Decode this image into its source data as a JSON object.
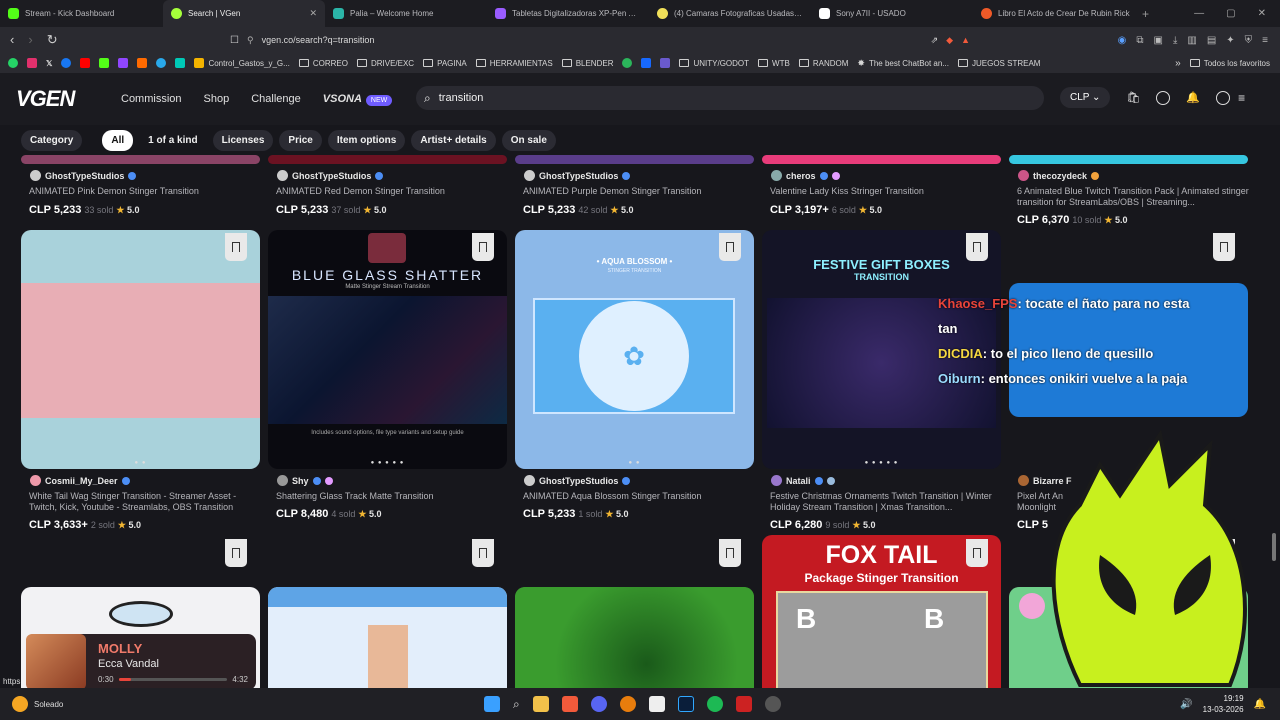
{
  "browser": {
    "tabs": [
      {
        "title": "Stream - Kick Dashboard",
        "color": "#53fc18"
      },
      {
        "title": "Search | VGen",
        "color": "#a6ff3b"
      },
      {
        "title": "Palia – Welcome Home",
        "color": "#2bb5a8"
      },
      {
        "title": "Tabletas Digitalizadoras XP-Pen Artis",
        "color": "#9a5cff"
      },
      {
        "title": "(4) Camaras Fotograficas Usadas | M",
        "color": "#f1e05a"
      },
      {
        "title": "Sony A7II - USADO",
        "color": "#ffffff"
      },
      {
        "title": "Libro El Acto de Crear De Rubin Rick",
        "color": "#f05a28"
      }
    ],
    "url": "vgen.co/search?q=transition",
    "bookmarks": [
      "Control_Gastos_y_G...",
      "CORREO",
      "DRIVE/EXC",
      "PAGINA",
      "HERRAMIENTAS",
      "BLENDER",
      "UNITY/GODOT",
      "WTB",
      "RANDOM",
      "The best ChatBot an...",
      "JUEGOS STREAM"
    ],
    "bookmarks_end": "Todos los favoritos"
  },
  "header": {
    "logo": "VGEN",
    "nav": [
      "Commission",
      "Shop",
      "Challenge",
      "VSONA"
    ],
    "new_badge": "NEW",
    "search_value": "transition",
    "currency": "CLP"
  },
  "filters": [
    "Category",
    "All",
    "1 of a kind",
    "Licenses",
    "Price",
    "Item options",
    "Artist+ details",
    "On sale"
  ],
  "row1": [
    {
      "seller": "GhostTypeStudios",
      "title": "ANIMATED Pink Demon Stinger Transition",
      "price": "CLP 5,233",
      "sold": "33 sold",
      "rating": "5.0"
    },
    {
      "seller": "GhostTypeStudios",
      "title": "ANIMATED Red Demon Stinger Transition",
      "price": "CLP 5,233",
      "sold": "37 sold",
      "rating": "5.0"
    },
    {
      "seller": "GhostTypeStudios",
      "title": "ANIMATED Purple Demon Stinger Transition",
      "price": "CLP 5,233",
      "sold": "42 sold",
      "rating": "5.0"
    },
    {
      "seller": "cheros",
      "title": "Valentine Lady Kiss Stringer Transition",
      "price": "CLP 3,197+",
      "sold": "6 sold",
      "rating": "5.0"
    },
    {
      "seller": "thecozydeck",
      "title": "6 Animated Blue Twitch Transition Pack | Animated stinger transition for StreamLabs/OBS | Streaming...",
      "price": "CLP 6,370",
      "sold": "10 sold",
      "rating": "5.0"
    }
  ],
  "row2": [
    {
      "seller": "Cosmii_My_Deer",
      "title": "White Tail Wag Stinger Transition - Streamer Asset - Twitch, Kick, Youtube - Streamlabs, OBS Transition",
      "price": "CLP 3,633+",
      "sold": "2 sold",
      "rating": "5.0"
    },
    {
      "seller": "Shy",
      "title": "Shattering Glass Track Matte Transition",
      "price": "CLP 8,480",
      "sold": "4 sold",
      "rating": "5.0",
      "thumb_title": "BLUE GLASS SHATTER",
      "thumb_sub": "Matte Stinger Stream Transition",
      "thumb_foot": "Includes sound options, file type variants and setup guide"
    },
    {
      "seller": "GhostTypeStudios",
      "title": "ANIMATED Aqua Blossom Stinger Transition",
      "price": "CLP 5,233",
      "sold": "1 sold",
      "rating": "5.0",
      "thumb_title": "• AQUA BLOSSOM •",
      "thumb_sub": "STINGER TRANSITION"
    },
    {
      "seller": "Natali",
      "title": "Festive Christmas Ornaments Twitch Transition | Winter Holiday Stream Transition | Xmas Transition...",
      "price": "CLP 6,280",
      "sold": "9 sold",
      "rating": "5.0",
      "thumb_title": "FESTIVE GIFT BOXES",
      "thumb_sub": "TRANSITION"
    },
    {
      "seller": "Bizarre F",
      "title": "Pixel Art An Moonlight",
      "price": "CLP 5"
    }
  ],
  "row3_fox": {
    "title": "FOX TAIL",
    "sub": "Package Stinger Transition"
  },
  "chat": [
    {
      "user": "Khaose_FPS",
      "msg": "tocate el ñato para no esta",
      "cont": "tan"
    },
    {
      "user": "DICDIA",
      "msg": "to el pico lleno de quesillo"
    },
    {
      "user": "Oiburn",
      "msg": "entonces onikiri vuelve a la paja"
    }
  ],
  "music": {
    "title": "MOLLY",
    "artist": "Ecca Vandal",
    "elapsed": "0:30",
    "total": "4:32",
    "progress": 0.11
  },
  "status_url": "https",
  "weather": "Soleado",
  "clock": {
    "time": "19:19",
    "date": "13-03-2026"
  }
}
